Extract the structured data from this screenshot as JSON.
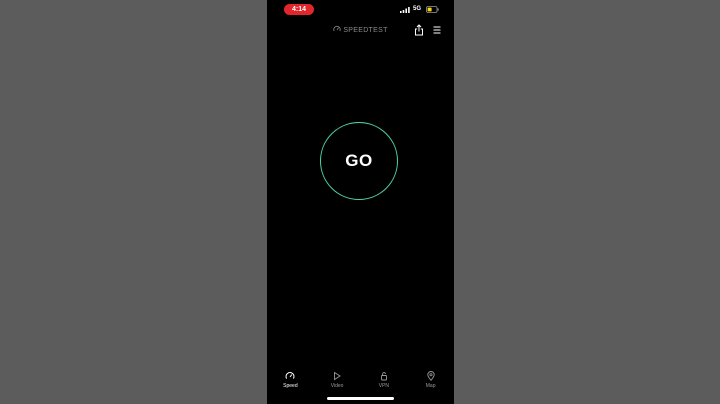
{
  "status_bar": {
    "time": "4:14",
    "network": "5G",
    "time_pill_color": "#e3262b",
    "battery_color": "#f5d90a"
  },
  "header": {
    "brand": "SPEEDTEST",
    "brand_icon": "gauge-icon",
    "share_icon": "share-icon",
    "menu_icon": "hamburger-menu-icon"
  },
  "main": {
    "go_label": "GO",
    "ring_color": "#4fd1a5"
  },
  "tabs": [
    {
      "label": "Speed",
      "icon": "speedometer-icon",
      "active": true
    },
    {
      "label": "Video",
      "icon": "play-icon",
      "active": false
    },
    {
      "label": "VPN",
      "icon": "lock-icon",
      "active": false
    },
    {
      "label": "Map",
      "icon": "map-pin-icon",
      "active": false
    }
  ]
}
